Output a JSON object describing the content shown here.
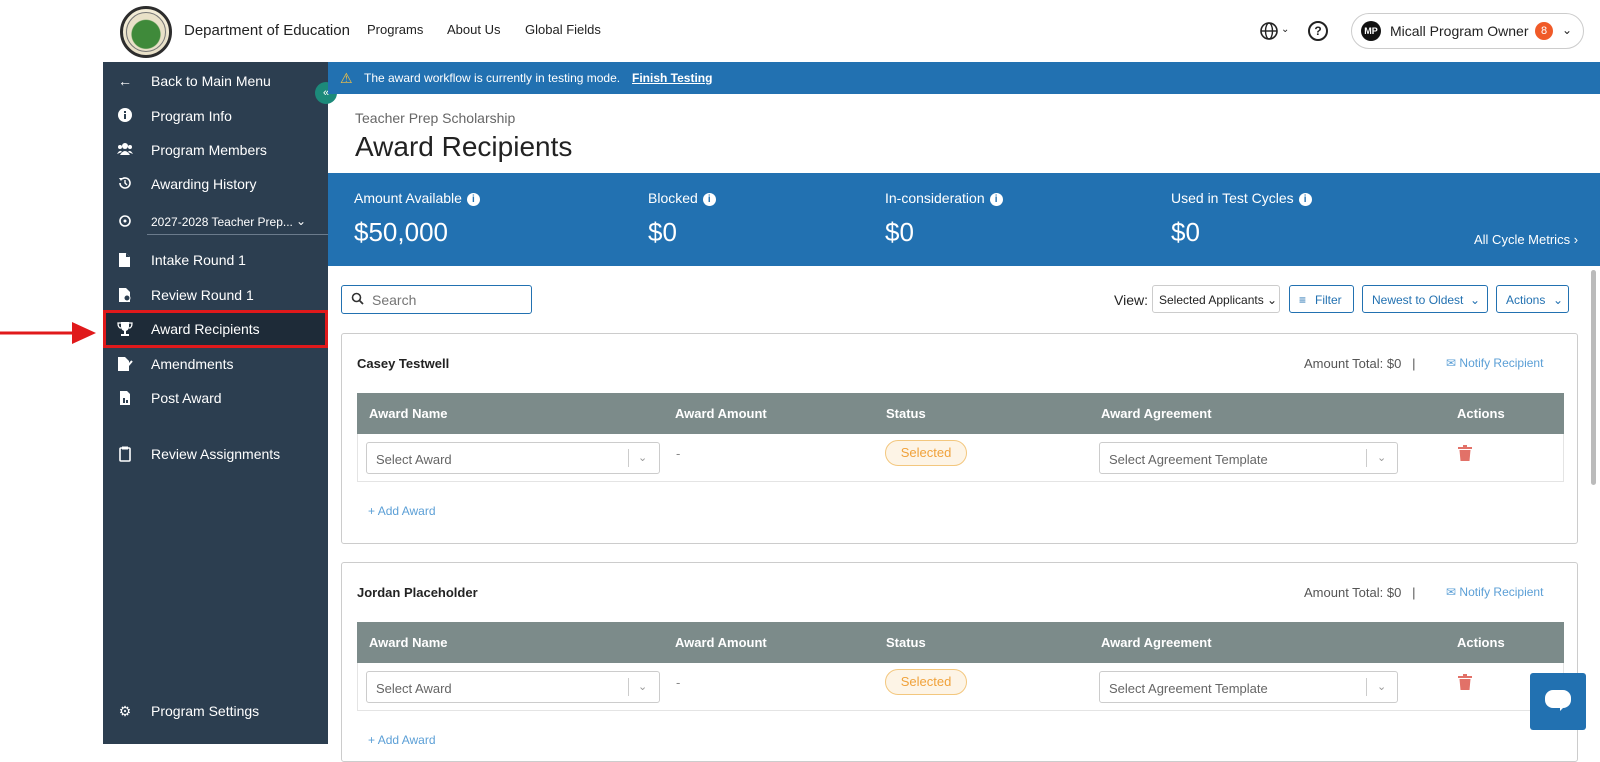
{
  "header": {
    "org_name": "Department of Education",
    "nav": [
      "Programs",
      "About Us",
      "Global Fields"
    ],
    "user": {
      "initials": "MP",
      "name": "Micall Program Owner",
      "badge": "8"
    }
  },
  "sidebar": {
    "items": [
      {
        "label": "Back to Main Menu",
        "icon": "arrow-left-icon"
      },
      {
        "label": "Program Info",
        "icon": "info-icon"
      },
      {
        "label": "Program Members",
        "icon": "users-icon"
      },
      {
        "label": "Awarding History",
        "icon": "history-icon"
      },
      {
        "label": "2027-2028 Teacher Prep...",
        "icon": "cycle-icon"
      },
      {
        "label": "Intake Round 1",
        "icon": "intake-icon"
      },
      {
        "label": "Review Round 1",
        "icon": "review-icon"
      },
      {
        "label": "Award Recipients",
        "icon": "trophy-icon"
      },
      {
        "label": "Amendments",
        "icon": "amendments-icon"
      },
      {
        "label": "Post Award",
        "icon": "post-award-icon"
      },
      {
        "label": "Review Assignments",
        "icon": "clipboard-icon"
      },
      {
        "label": "Program Settings",
        "icon": "gear-icon"
      }
    ]
  },
  "banner": {
    "text": "The award workflow is currently in testing mode.",
    "link": "Finish Testing"
  },
  "breadcrumb": "Teacher Prep Scholarship",
  "page_title": "Award Recipients",
  "metrics": [
    {
      "label": "Amount Available",
      "value": "$50,000"
    },
    {
      "label": "Blocked",
      "value": "$0"
    },
    {
      "label": "In-consideration",
      "value": "$0"
    },
    {
      "label": "Used in Test Cycles",
      "value": "$0"
    }
  ],
  "metrics_link": "All Cycle Metrics",
  "toolbar": {
    "search_placeholder": "Search",
    "view_label": "View:",
    "view_value": "Selected Applicants",
    "filter": "Filter",
    "sort": "Newest to Oldest",
    "actions": "Actions"
  },
  "table_headers": [
    "Award Name",
    "Award Amount",
    "Status",
    "Award Agreement",
    "Actions"
  ],
  "recipients": [
    {
      "name": "Casey Testwell",
      "amount_total": "Amount Total: $0",
      "notify": "Notify Recipient",
      "award_placeholder": "Select Award",
      "amount": "-",
      "status": "Selected",
      "agreement_placeholder": "Select Agreement Template",
      "add_award": "Add Award"
    },
    {
      "name": "Jordan Placeholder",
      "amount_total": "Amount Total: $0",
      "notify": "Notify Recipient",
      "award_placeholder": "Select Award",
      "amount": "-",
      "status": "Selected",
      "agreement_placeholder": "Select Agreement Template",
      "add_award": "Add Award"
    }
  ],
  "colors": {
    "sidebar_bg": "#2c3e50",
    "accent_blue": "#2271b1",
    "table_header": "#7c8b8a",
    "status_orange": "#f0a23b",
    "highlight_red": "#e0191b"
  }
}
